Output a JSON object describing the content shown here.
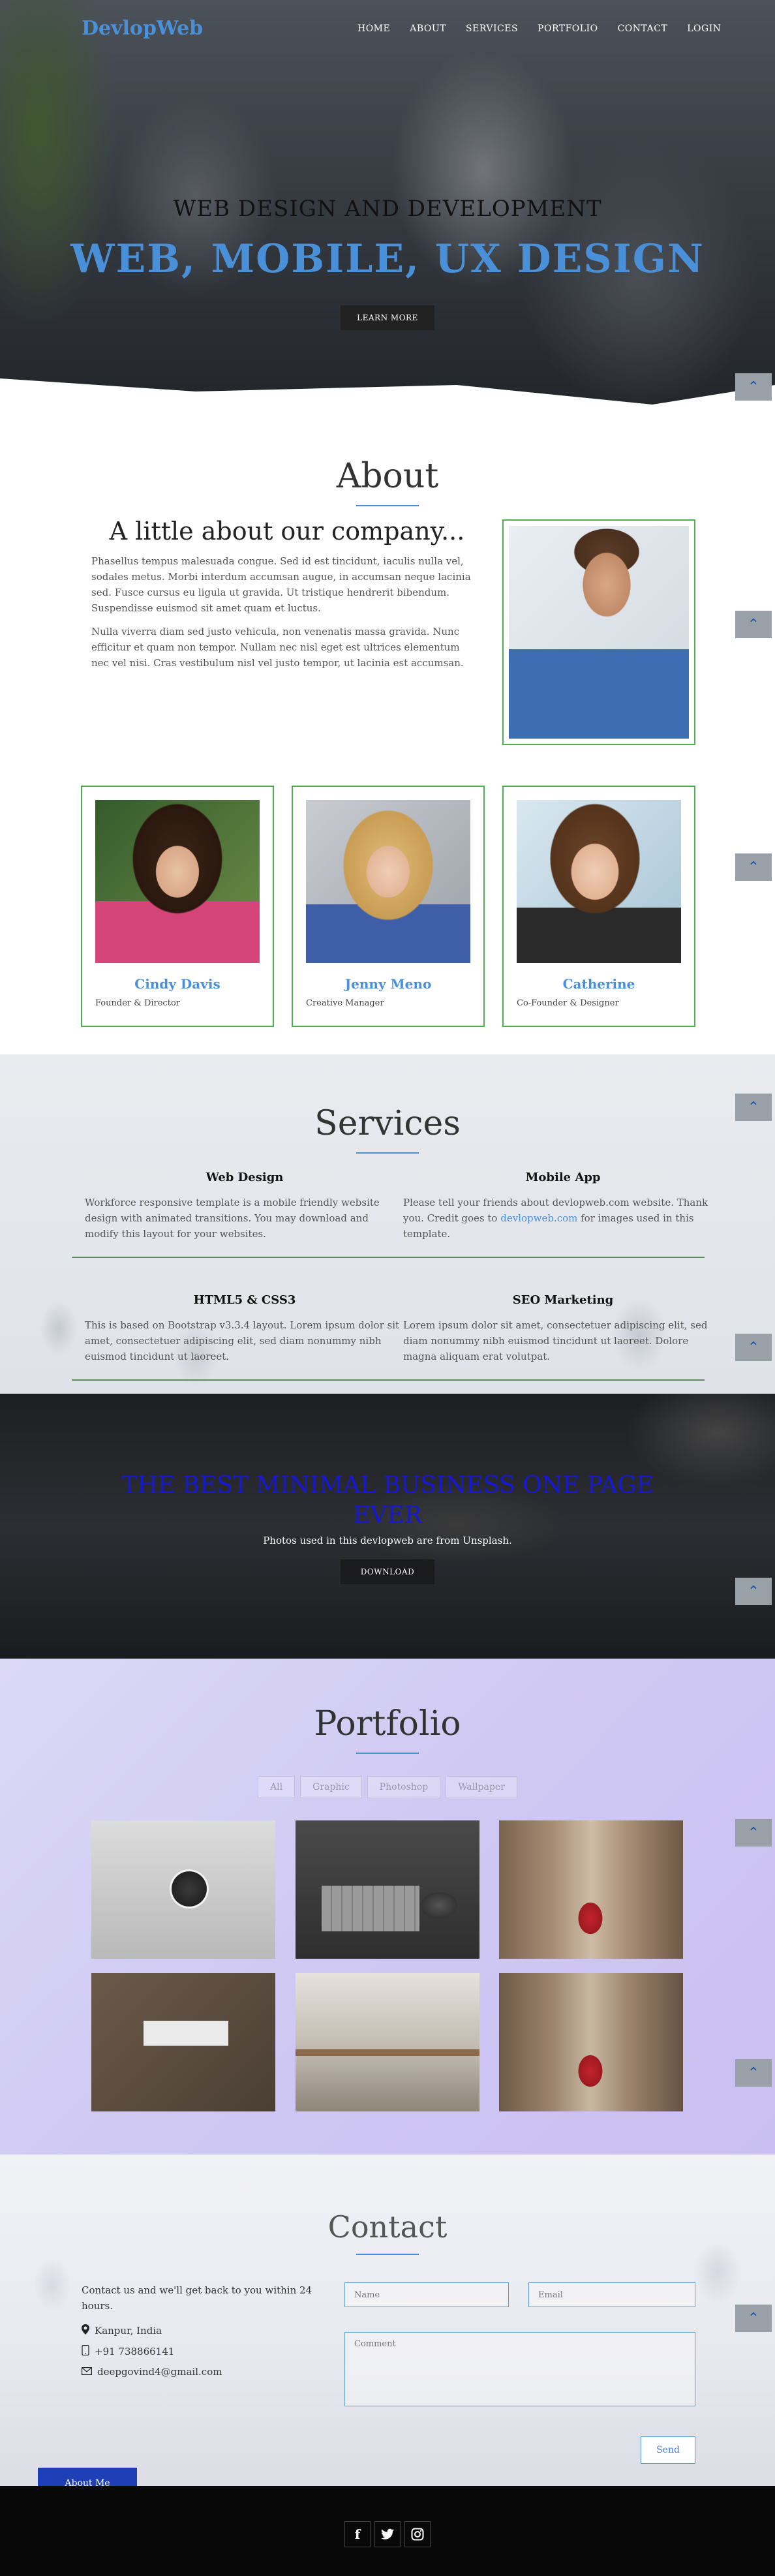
{
  "brand": "DevlopWeb",
  "nav": [
    "HOME",
    "ABOUT",
    "SERVICES",
    "PORTFOLIO",
    "CONTACT",
    "LOGIN"
  ],
  "hero": {
    "subtitle": "WEB DESIGN AND DEVELOPMENT",
    "title": "WEB, MOBILE, UX DESIGN",
    "button": "LEARN MORE"
  },
  "about": {
    "title": "About",
    "heading": "A little about our company...",
    "paragraphs": [
      "Phasellus tempus malesuada congue. Sed id est tincidunt, iaculis nulla vel, sodales metus. Morbi interdum accumsan augue, in accumsan neque lacinia sed. Fusce cursus eu ligula ut gravida. Ut tristique hendrerit bibendum. Suspendisse euismod sit amet quam et luctus.",
      "Nulla viverra diam sed justo vehicula, non venenatis massa gravida. Nunc efficitur et quam non tempor. Nullam nec nisl eget est ultrices elementum nec vel nisi. Cras vestibulum nisl vel justo tempor, ut lacinia est accumsan."
    ],
    "team": [
      {
        "name": "Cindy Davis",
        "role": "Founder & Director"
      },
      {
        "name": "Jenny Meno",
        "role": "Creative Manager"
      },
      {
        "name": "Catherine",
        "role": "Co-Founder & Designer"
      }
    ]
  },
  "services": {
    "title": "Services",
    "items": [
      {
        "title": "Web Design",
        "text": "Workforce responsive template is a mobile friendly website design with animated transitions. You may download and modify this layout for your websites."
      },
      {
        "title": "Mobile App",
        "text_before": "Please tell your friends about devlopweb.com website. Thank you. Credit goes to ",
        "link": "devlopweb.com",
        "text_after": " for images used in this template."
      },
      {
        "title": "HTML5 & CSS3",
        "text": "This is based on Bootstrap v3.3.4 layout. Lorem ipsum dolor sit amet, consectetuer adipiscing elit, sed diam nonummy nibh euismod tincidunt ut laoreet."
      },
      {
        "title": "SEO Marketing",
        "text": "Lorem ipsum dolor sit amet, consectetuer adipiscing elit, sed diam nonummy nibh euismod tincidunt ut laoreet. Dolore magna aliquam erat volutpat."
      }
    ]
  },
  "cta": {
    "title": "THE BEST MINIMAL BUSINESS ONE PAGE EVER",
    "subtitle": "Photos used in this devlopweb are from Unsplash.",
    "button": "DOWNLOAD"
  },
  "portfolio": {
    "title": "Portfolio",
    "filters": [
      "All",
      "Graphic",
      "Photoshop",
      "Wallpaper"
    ]
  },
  "contact": {
    "title": "Contact",
    "intro": "Contact us and we'll get back to you within 24 hours.",
    "location": "Kanpur, India",
    "phone": "+91 738866141",
    "email": "deepgovind4@gmail.com",
    "name_placeholder": "Name",
    "email_placeholder": "Email",
    "comment_placeholder": "Comment",
    "send": "Send",
    "about_me": "About Me"
  },
  "scroll_up_glyph": "⌃",
  "social": [
    "f",
    "twitter",
    "instagram"
  ],
  "colors": {
    "accent": "#4a90d9",
    "card_border": "#4caf50",
    "cta_title": "#1717d6",
    "footer": "#080808"
  }
}
